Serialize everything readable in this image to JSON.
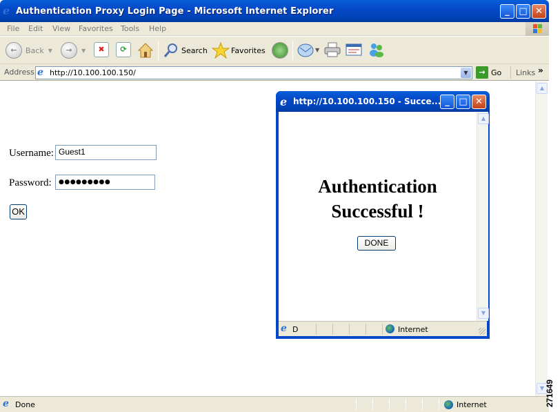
{
  "window": {
    "title": "Authentication Proxy Login Page - Microsoft Internet Explorer"
  },
  "menu": [
    "File",
    "Edit",
    "View",
    "Favorites",
    "Tools",
    "Help"
  ],
  "toolbar": {
    "back_label": "Back",
    "search_label": "Search",
    "favorites_label": "Favorites"
  },
  "address": {
    "label": "Address",
    "url": "http://10.100.100.150/",
    "go_label": "Go",
    "links_label": "Links",
    "chevron": "»"
  },
  "form": {
    "username_label": "Username:",
    "username_value": "Guest1",
    "password_label": "Password:",
    "password_value": "●●●●●●●●●",
    "ok_label": "OK"
  },
  "status": {
    "text": "Done",
    "zone": "Internet"
  },
  "popup": {
    "title": "http://10.100.100.150 - Succe...",
    "message_line1": "Authentication",
    "message_line2": "Successful !",
    "done_label": "DONE",
    "status_text": "D",
    "zone": "Internet"
  },
  "figure_id": "271649"
}
